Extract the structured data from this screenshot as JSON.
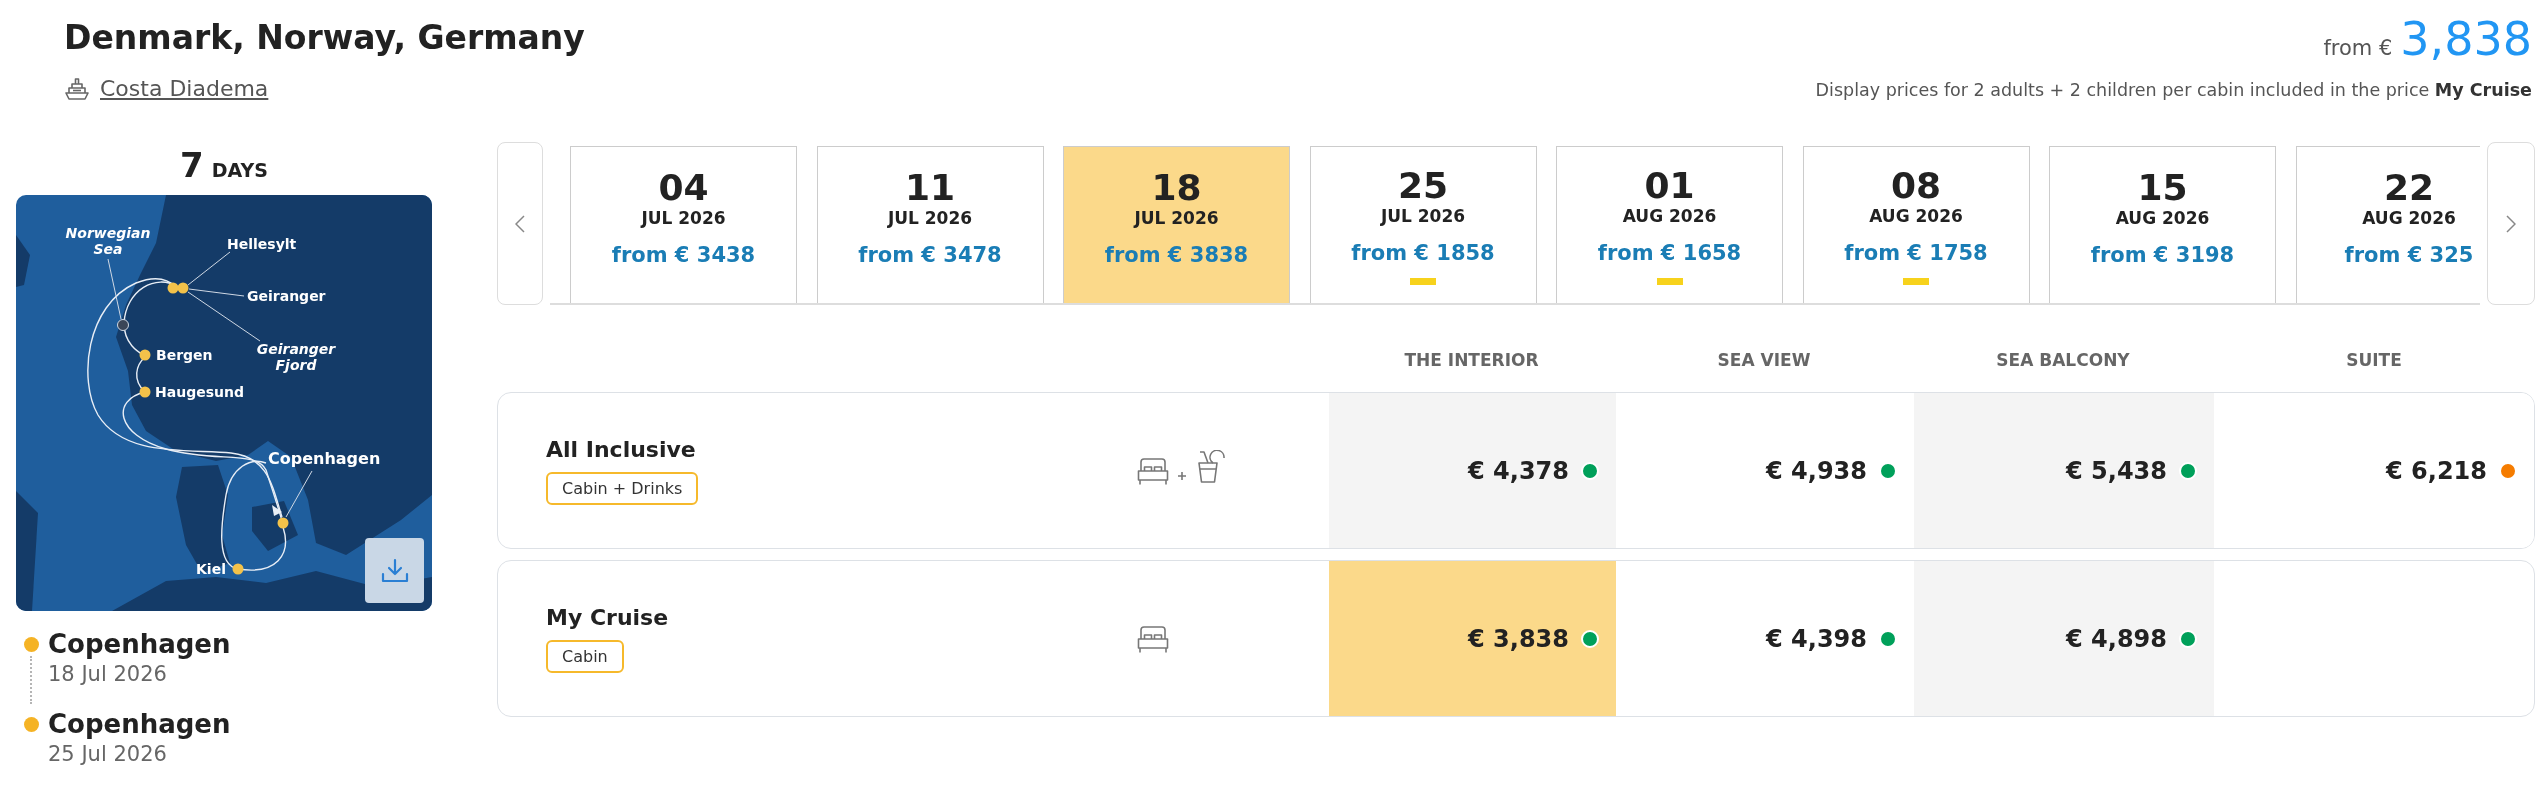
{
  "header": {
    "title": "Denmark, Norway, Germany",
    "ship": "Costa Diadema",
    "price_prefix": "from €",
    "price": "3,838",
    "note": "Display prices for 2 adults + 2 children per cabin included in the price **My Cruise**"
  },
  "itinerary": {
    "days": "7",
    "unit": "DAYS",
    "map_labels": [
      {
        "text": "Norwegian Sea",
        "kind": "water"
      },
      {
        "text": "Hellesylt",
        "kind": "port"
      },
      {
        "text": "Geiranger",
        "kind": "port"
      },
      {
        "text": "Bergen",
        "kind": "port"
      },
      {
        "text": "Geiranger Fjord",
        "kind": "water"
      },
      {
        "text": "Haugesund",
        "kind": "port"
      },
      {
        "text": "Copenhagen",
        "kind": "home"
      },
      {
        "text": "Kiel",
        "kind": "port"
      }
    ],
    "stops": [
      {
        "port": "Copenhagen",
        "date": "18 Jul 2026"
      },
      {
        "port": "Copenhagen",
        "date": "25 Jul 2026"
      }
    ]
  },
  "dates": [
    {
      "day": "04",
      "month": "JUL 2026",
      "price": "from € 3438",
      "selected": false,
      "marked": false
    },
    {
      "day": "11",
      "month": "JUL 2026",
      "price": "from € 3478",
      "selected": false,
      "marked": false
    },
    {
      "day": "18",
      "month": "JUL 2026",
      "price": "from € 3838",
      "selected": true,
      "marked": false
    },
    {
      "day": "25",
      "month": "JUL 2026",
      "price": "from € 1858",
      "selected": false,
      "marked": true
    },
    {
      "day": "01",
      "month": "AUG 2026",
      "price": "from € 1658",
      "selected": false,
      "marked": true
    },
    {
      "day": "08",
      "month": "AUG 2026",
      "price": "from € 1758",
      "selected": false,
      "marked": true
    },
    {
      "day": "15",
      "month": "AUG 2026",
      "price": "from € 3198",
      "selected": false,
      "marked": false
    },
    {
      "day": "22",
      "month": "AUG 2026",
      "price": "from € 325",
      "selected": false,
      "marked": false
    }
  ],
  "cabin_types": [
    "THE INTERIOR",
    "SEA VIEW",
    "SEA BALCONY",
    "SUITE"
  ],
  "packages": [
    {
      "name": "All Inclusive",
      "tag": "Cabin + Drinks",
      "kind": "cabin_drinks",
      "prices": [
        {
          "amount": "€ 4,378",
          "color": "#00a05a",
          "selected": false
        },
        {
          "amount": "€ 4,938",
          "color": "#00a05a",
          "selected": false
        },
        {
          "amount": "€ 5,438",
          "color": "#00a05a",
          "selected": false
        },
        {
          "amount": "€ 6,218",
          "color": "#f57c00",
          "selected": false
        }
      ]
    },
    {
      "name": "My Cruise",
      "tag": "Cabin",
      "kind": "cabin",
      "prices": [
        {
          "amount": "€ 3,838",
          "color": "#00a05a",
          "selected": true
        },
        {
          "amount": "€ 4,398",
          "color": "#00a05a",
          "selected": false
        },
        {
          "amount": "€ 4,898",
          "color": "#00a05a",
          "selected": false
        }
      ]
    }
  ]
}
